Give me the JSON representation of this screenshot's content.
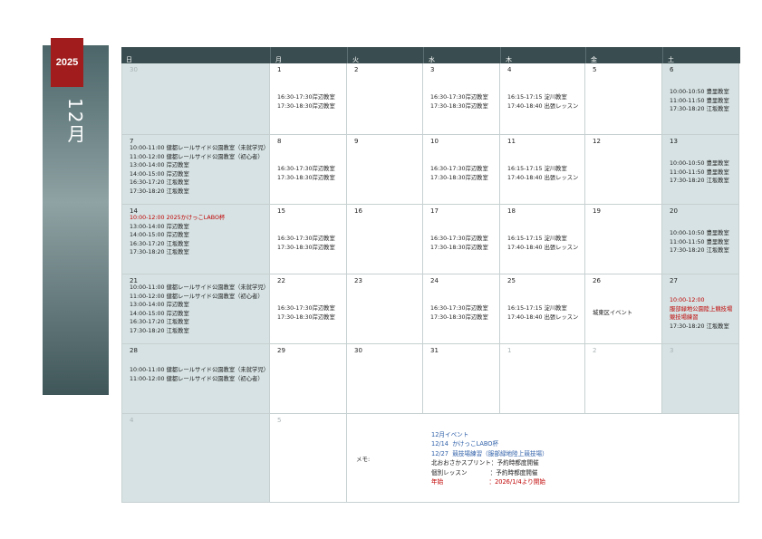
{
  "year": "2025",
  "month": "12月",
  "weekdays": [
    "日",
    "月",
    "火",
    "水",
    "木",
    "金",
    "土"
  ],
  "weeks": [
    [
      {
        "day": "30",
        "dim": true,
        "lines": []
      },
      {
        "day": "1",
        "lines": [
          {
            "t": "16:30-17:30岸辺教室"
          },
          {
            "t": "17:30-18:30岸辺教室"
          }
        ]
      },
      {
        "day": "2",
        "lines": []
      },
      {
        "day": "3",
        "lines": [
          {
            "t": "16:30-17:30岸辺教室"
          },
          {
            "t": "17:30-18:30岸辺教室"
          }
        ]
      },
      {
        "day": "4",
        "lines": [
          {
            "t": "16:15-17:15  淀川教室"
          },
          {
            "t": "17:40-18:40  出張レッスン"
          }
        ]
      },
      {
        "day": "5",
        "lines": []
      },
      {
        "day": "6",
        "lines": [
          {
            "t": "10:00-10:50  豊里教室"
          },
          {
            "t": "11:00-11:50  豊里教室"
          },
          {
            "t": "17:30-18:20  江坂教室"
          }
        ]
      }
    ],
    [
      {
        "day": "7",
        "lines": [
          {
            "t": "10:00-11:00  健都レールサイド公園教室（未就学児）"
          },
          {
            "t": "11:00-12:00  健都レールサイド公園教室（初心者）"
          },
          {
            "t": "13:00-14:00  岸辺教室"
          },
          {
            "t": "14:00-15:00  岸辺教室"
          },
          {
            "t": "16:30-17:20  江坂教室"
          },
          {
            "t": "17:30-18:20  江坂教室"
          }
        ]
      },
      {
        "day": "8",
        "lines": [
          {
            "t": "16:30-17:30岸辺教室"
          },
          {
            "t": "17:30-18:30岸辺教室"
          }
        ]
      },
      {
        "day": "9",
        "lines": []
      },
      {
        "day": "10",
        "lines": [
          {
            "t": "16:30-17:30岸辺教室"
          },
          {
            "t": "17:30-18:30岸辺教室"
          }
        ]
      },
      {
        "day": "11",
        "lines": [
          {
            "t": "16:15-17:15  淀川教室"
          },
          {
            "t": "17:40-18:40  出張レッスン"
          }
        ]
      },
      {
        "day": "12",
        "lines": []
      },
      {
        "day": "13",
        "lines": [
          {
            "t": "10:00-10:50  豊里教室"
          },
          {
            "t": "11:00-11:50  豊里教室"
          },
          {
            "t": "17:30-18:20  江坂教室"
          }
        ]
      }
    ],
    [
      {
        "day": "14",
        "lines": [
          {
            "t": "10:00-12:00  2025かけっこLABO杯",
            "red": true
          },
          {
            "t": "13:00-14:00  岸辺教室"
          },
          {
            "t": "14:00-15:00  岸辺教室"
          },
          {
            "t": "16:30-17:20  江坂教室"
          },
          {
            "t": "17:30-18:20  江坂教室"
          }
        ]
      },
      {
        "day": "15",
        "lines": [
          {
            "t": "16:30-17:30岸辺教室"
          },
          {
            "t": "17:30-18:30岸辺教室"
          }
        ]
      },
      {
        "day": "16",
        "lines": []
      },
      {
        "day": "17",
        "lines": [
          {
            "t": "16:30-17:30岸辺教室"
          },
          {
            "t": "17:30-18:30岸辺教室"
          }
        ]
      },
      {
        "day": "18",
        "lines": [
          {
            "t": "16:15-17:15  淀川教室"
          },
          {
            "t": "17:40-18:40  出張レッスン"
          }
        ]
      },
      {
        "day": "19",
        "lines": []
      },
      {
        "day": "20",
        "lines": [
          {
            "t": "10:00-10:50  豊里教室"
          },
          {
            "t": "11:00-11:50  豊里教室"
          },
          {
            "t": "17:30-18:20  江坂教室"
          }
        ]
      }
    ],
    [
      {
        "day": "21",
        "lines": [
          {
            "t": "10:00-11:00  健都レールサイド公園教室（未就学児）"
          },
          {
            "t": "11:00-12:00  健都レールサイド公園教室（初心者）"
          },
          {
            "t": "13:00-14:00  岸辺教室"
          },
          {
            "t": "14:00-15:00  岸辺教室"
          },
          {
            "t": "16:30-17:20  江坂教室"
          },
          {
            "t": "17:30-18:20  江坂教室"
          }
        ]
      },
      {
        "day": "22",
        "lines": [
          {
            "t": "16:30-17:30岸辺教室"
          },
          {
            "t": "17:30-18:30岸辺教室"
          }
        ]
      },
      {
        "day": "23",
        "lines": []
      },
      {
        "day": "24",
        "lines": [
          {
            "t": "16:30-17:30岸辺教室"
          },
          {
            "t": "17:30-18:30岸辺教室"
          }
        ]
      },
      {
        "day": "25",
        "lines": [
          {
            "t": "16:15-17:15  淀川教室"
          },
          {
            "t": "17:40-18:40  出張レッスン"
          }
        ]
      },
      {
        "day": "26",
        "lines": [
          {
            "t": "城東区イベント"
          }
        ]
      },
      {
        "day": "27",
        "lines": [
          {
            "t": "10:00-12:00",
            "red": true
          },
          {
            "t": "服部緑地公園陸上競技場",
            "red": true
          },
          {
            "t": "競技場練習",
            "red": true
          },
          {
            "t": "17:30-18:20  江坂教室"
          }
        ]
      }
    ],
    [
      {
        "day": "28",
        "lines": [
          {
            "t": "10:00-11:00  健都レールサイド公園教室（未就学児）"
          },
          {
            "t": "11:00-12:00  健都レールサイド公園教室（初心者）"
          }
        ]
      },
      {
        "day": "29",
        "lines": []
      },
      {
        "day": "30",
        "lines": []
      },
      {
        "day": "31",
        "lines": []
      },
      {
        "day": "1",
        "dim": true,
        "lines": []
      },
      {
        "day": "2",
        "dim": true,
        "lines": []
      },
      {
        "day": "3",
        "dim": true,
        "lines": []
      }
    ],
    [
      {
        "day": "4",
        "dim": true,
        "lines": []
      },
      {
        "day": "5",
        "dim": true,
        "lines": []
      }
    ]
  ],
  "memo": {
    "label": "メモ:",
    "lines": [
      {
        "t": "12月イベント",
        "c": "blue"
      },
      {
        "t": "12/14  かけっこLABO杯",
        "c": "blue"
      },
      {
        "t": "12/27  競技場練習（服部緑地陸上競技場）",
        "c": "blue"
      },
      {
        "t": "北おおさかスプリント：予約時都度開催",
        "c": ""
      },
      {
        "t": "個別レッスン            ：予約時都度開催",
        "c": ""
      },
      {
        "t": "年始                        ：2026/1/4より開始",
        "c": "red"
      }
    ]
  },
  "colors": {
    "header": "#394c4f",
    "year_tab": "#a11d1d",
    "shade": "#d6e2e3",
    "red": "#c00000",
    "blue": "#2e5fa8"
  }
}
